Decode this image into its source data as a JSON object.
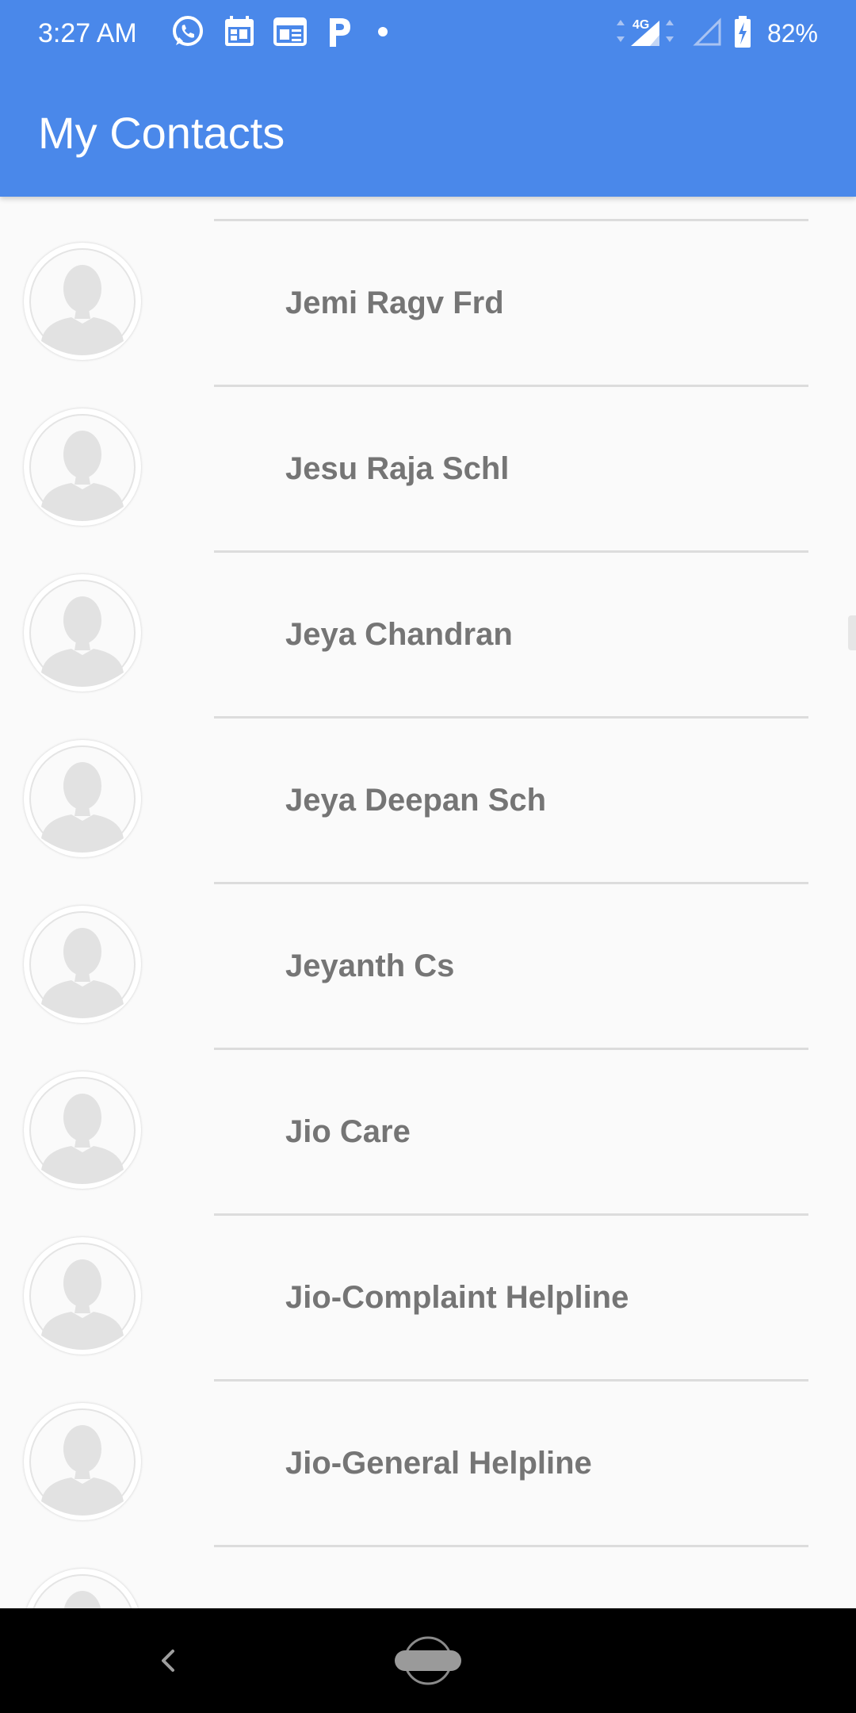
{
  "status_bar": {
    "time": "3:27 AM",
    "battery_percent": "82%",
    "network": "4G",
    "notification_icons": [
      "whatsapp-icon",
      "calendar-icon",
      "news-icon",
      "parking-icon",
      "dot-icon"
    ],
    "colors": {
      "background": "#4a88ea",
      "text": "#ffffff"
    }
  },
  "app_bar": {
    "title": "My Contacts",
    "color": "#4a88ea"
  },
  "contacts": [
    {
      "name": "Jemi Ragv Frd"
    },
    {
      "name": "Jesu Raja Schl"
    },
    {
      "name": "Jeya Chandran"
    },
    {
      "name": "Jeya Deepan Sch"
    },
    {
      "name": "Jeyanth Cs"
    },
    {
      "name": "Jio Care"
    },
    {
      "name": "Jio-Complaint Helpline"
    },
    {
      "name": "Jio-General Helpline"
    },
    {
      "name": ""
    }
  ],
  "nav_bar": {
    "buttons": [
      "back-icon",
      "home-icon"
    ]
  }
}
